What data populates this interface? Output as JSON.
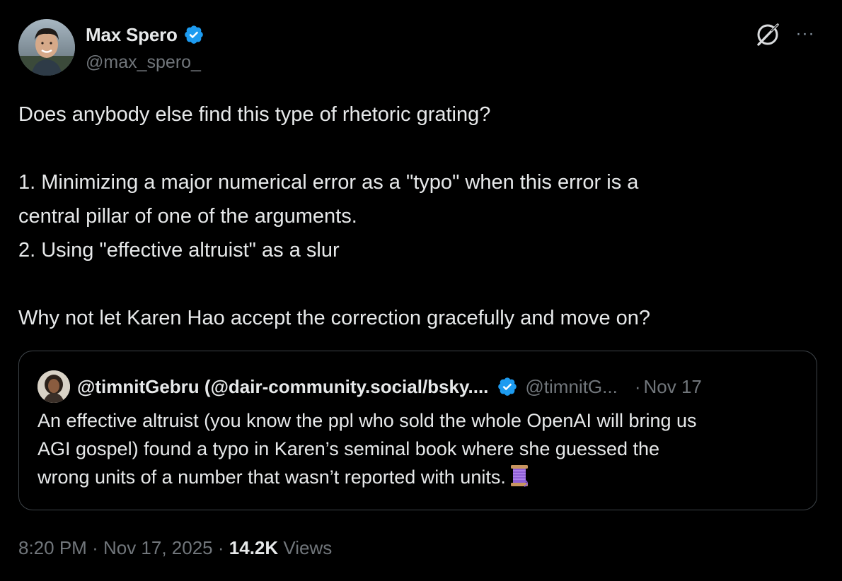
{
  "author": {
    "display_name": "Max Spero",
    "handle": "@max_spero_",
    "verified_badge_color": "#1d9bf0"
  },
  "header_icons": {
    "grok": "grok-icon",
    "more": "···"
  },
  "tweet": {
    "lines": [
      "Does anybody else find this type of rhetoric grating?",
      "",
      "1. Minimizing a major numerical error as a \"typo\" when this error is a",
      "central pillar of one of the arguments.",
      "2. Using \"effective altruist\" as a slur",
      "",
      "Why not let Karen Hao accept the correction gracefully and move on?"
    ]
  },
  "quote": {
    "display_name": "@timnitGebru (@dair-community.social/bsky....",
    "handle": "@timnitG...",
    "separator": "·",
    "date": "Nov 17",
    "lines": [
      "An effective altruist (you know the ppl who sold the whole OpenAI will bring us",
      "AGI gospel) found a typo in Karen’s seminal book where she guessed the",
      "wrong units of a number that wasn’t reported with units."
    ],
    "trailing_emoji": "spool-of-thread-icon"
  },
  "footer": {
    "time": "8:20 PM",
    "sep1": "·",
    "date": "Nov 17, 2025",
    "sep2": "·",
    "views_count": "14.2K",
    "views_label": "Views"
  },
  "colors": {
    "background": "#000000",
    "text_primary": "#e7e9ea",
    "text_secondary": "#71767b",
    "border": "#3e4449",
    "verified": "#1d9bf0"
  }
}
